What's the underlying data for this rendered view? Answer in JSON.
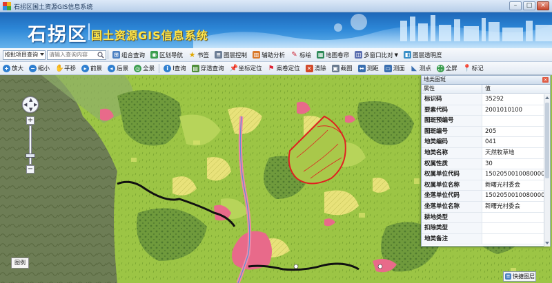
{
  "window": {
    "title": "石拐区国土资源GIS信息系统",
    "minimize": "–",
    "maximize": "□",
    "close": "×"
  },
  "banner": {
    "district": "石拐区",
    "system_name": "国土资源GIS信息系统"
  },
  "toolbar_top": {
    "query_type_selected": "按批项目查询",
    "search_placeholder": "请输入查询内容",
    "items": [
      {
        "label": "组合查询",
        "icon": "combo-query-icon"
      },
      {
        "label": "区划导航",
        "icon": "region-nav-icon"
      },
      {
        "label": "书签",
        "icon": "star-bookmark-icon"
      },
      {
        "label": "图层控制",
        "icon": "layer-control-icon"
      },
      {
        "label": "辅助分析",
        "icon": "chart-analysis-icon"
      },
      {
        "label": "标绘",
        "icon": "plot-draw-icon"
      },
      {
        "label": "地图卷帘",
        "icon": "map-swipe-icon"
      },
      {
        "label": "多窗口比对",
        "icon": "multi-window-icon"
      },
      {
        "label": "图层透明度",
        "icon": "layer-transparency-icon"
      }
    ]
  },
  "toolbar_tools": {
    "items": [
      {
        "label": "放大",
        "icon": "zoom-in-icon"
      },
      {
        "label": "缩小",
        "icon": "zoom-out-icon"
      },
      {
        "label": "平移",
        "icon": "pan-hand-icon"
      },
      {
        "label": "前景",
        "icon": "forward-view-icon"
      },
      {
        "label": "后景",
        "icon": "back-view-icon"
      },
      {
        "label": "全景",
        "icon": "full-extent-icon"
      },
      {
        "label": "I查询",
        "icon": "info-query-icon"
      },
      {
        "label": "穿透查询",
        "icon": "penetrate-query-icon"
      },
      {
        "label": "坐标定位",
        "icon": "coordinate-pin-icon"
      },
      {
        "label": "案卷定位",
        "icon": "case-flag-icon"
      },
      {
        "label": "清除",
        "icon": "clear-icon"
      },
      {
        "label": "截图",
        "icon": "screenshot-icon"
      },
      {
        "label": "测距",
        "icon": "measure-distance-icon"
      },
      {
        "label": "测面",
        "icon": "measure-area-icon"
      },
      {
        "label": "测点",
        "icon": "measure-point-icon"
      },
      {
        "label": "全屏",
        "icon": "fullscreen-icon"
      },
      {
        "label": "标记",
        "icon": "marker-icon"
      }
    ]
  },
  "map": {
    "legend_button": "图例",
    "quick_layer_button": "快捷图层"
  },
  "attribute_panel": {
    "title": "地类图斑",
    "col_attr": "属性",
    "col_value": "值",
    "rows": [
      {
        "k": "标识码",
        "v": "35292"
      },
      {
        "k": "要素代码",
        "v": "2001010100"
      },
      {
        "k": "图斑预编号",
        "v": ""
      },
      {
        "k": "图斑编号",
        "v": "205"
      },
      {
        "k": "地类编码",
        "v": "041"
      },
      {
        "k": "地类名称",
        "v": "天然牧草地"
      },
      {
        "k": "权属性质",
        "v": "30"
      },
      {
        "k": "权属单位代码",
        "v": "1502050010080000"
      },
      {
        "k": "权属单位名称",
        "v": "新曙光村委会"
      },
      {
        "k": "坐落单位代码",
        "v": "1502050010080000"
      },
      {
        "k": "坐落单位名称",
        "v": "新曙光村委会"
      },
      {
        "k": "耕地类型",
        "v": ""
      },
      {
        "k": "扣除类型",
        "v": ""
      },
      {
        "k": "地类备注",
        "v": ""
      }
    ]
  },
  "colors": {
    "banner_blue": "#2c86d6",
    "banner_title": "#ffe64a",
    "grass_green": "#8cbf3a",
    "forest_dark": "#4f7a2e",
    "urban_pink": "#e86a8a",
    "road_black": "#111111",
    "selection_red": "#e02020"
  }
}
